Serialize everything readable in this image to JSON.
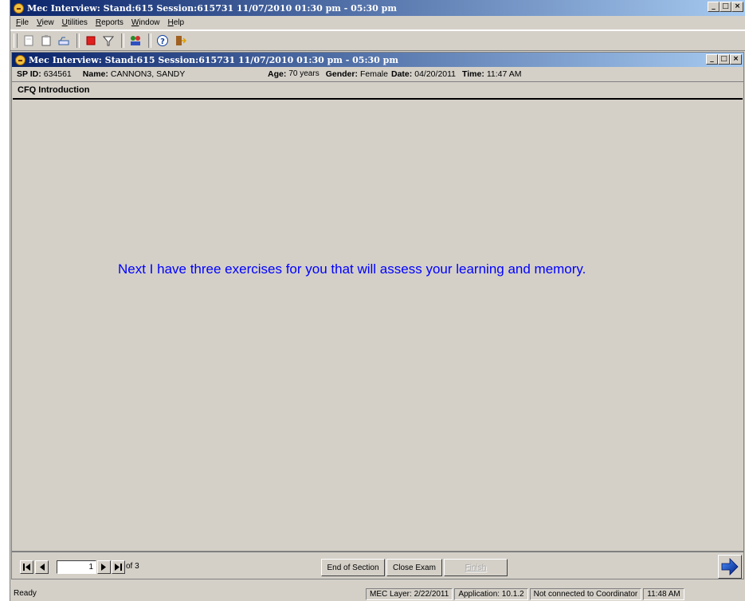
{
  "app": {
    "title": "Mec Interview: Stand:615 Session:615731 11/07/2010 01:30 pm - 05:30 pm"
  },
  "menu": [
    {
      "label": "File",
      "u": "F",
      "rest": "ile"
    },
    {
      "label": "View",
      "u": "V",
      "rest": "iew"
    },
    {
      "label": "Utilities",
      "u": "U",
      "rest": "tilities"
    },
    {
      "label": "Reports",
      "u": "R",
      "rest": "eports"
    },
    {
      "label": "Window",
      "u": "W",
      "rest": "indow"
    },
    {
      "label": "Help",
      "u": "H",
      "rest": "elp"
    }
  ],
  "toolbar_icons": [
    "new-icon",
    "clipboard-icon",
    "open-icon",
    "stop-icon",
    "filter-icon",
    "people-icon",
    "help-icon",
    "exit-icon"
  ],
  "inner_window": {
    "title": "Mec Interview: Stand:615 Session:615731 11/07/2010 01:30 pm - 05:30 pm"
  },
  "participant": {
    "sp_id_label": "SP ID:",
    "sp_id": "634561",
    "name_label": "Name:",
    "name": "CANNON3, SANDY",
    "age_label": "Age:",
    "age": "70 years",
    "gender_label": "Gender:",
    "gender": "Female",
    "date_label": "Date:",
    "date": "04/20/2011",
    "time_label": "Time:",
    "time": "11:47 AM"
  },
  "section": {
    "title": "CFQ Introduction"
  },
  "question": {
    "text": "Next I have three exercises for you that will assess your learning and memory."
  },
  "navigation": {
    "page": "1",
    "of_label": "of 3",
    "end_of_section": "End of Section",
    "close_exam": "Close Exam",
    "finish": "Finish"
  },
  "status": {
    "ready": "Ready",
    "mec_layer": "MEC Layer: 2/22/2011",
    "application": "Application: 10.1.2",
    "coordinator": "Not connected to Coordinator",
    "clock": "11:48 AM"
  },
  "colors": {
    "titlebar_start": "#0a246a",
    "titlebar_end": "#a6caf0",
    "question_text": "#0000ff",
    "window_bg": "#d4d0c8"
  }
}
